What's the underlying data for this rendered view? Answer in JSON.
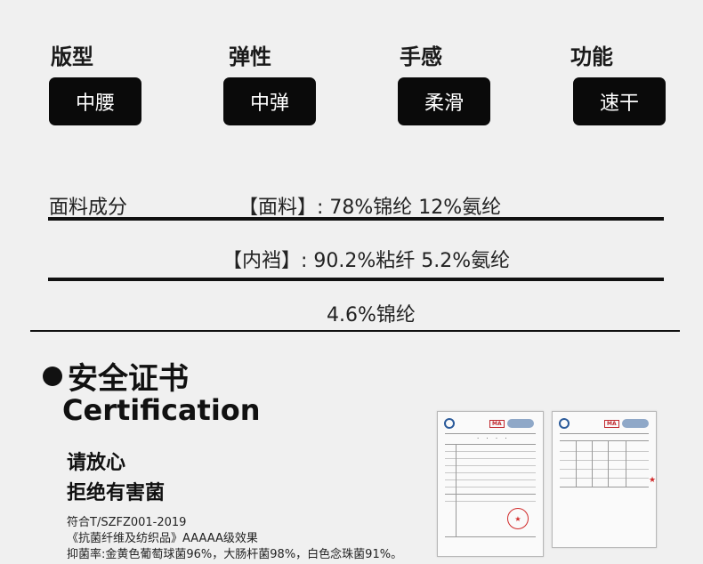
{
  "attributes": [
    {
      "label": "版型",
      "value": "中腰"
    },
    {
      "label": "弹性",
      "value": "中弹"
    },
    {
      "label": "手感",
      "value": "柔滑"
    },
    {
      "label": "功能",
      "value": "速干"
    }
  ],
  "fabric": {
    "label": "面料成分",
    "outer": "【面料】: 78%锦纶 12%氨纶",
    "lining": "【内裆】: 90.2%粘纤 5.2%氨纶",
    "lining_cont": "4.6%锦纶"
  },
  "certification": {
    "title": "安全证书",
    "subtitle": "Certification",
    "reassure_line1": "请放心",
    "reassure_line2": "拒绝有害菌",
    "standard_line1": "符合T/SZFZ001-2019",
    "standard_line2": "《抗菌纤维及纺织品》AAAAA级效果",
    "standard_line3": "抑菌率:金黄色葡萄球菌96%，大肠杆菌98%，白色念珠菌91%。"
  },
  "colors": {
    "tag_bg": "#0a0a0a",
    "tag_text": "#ffffff",
    "page_bg": "#f0f0f0",
    "stamp_red": "#d12a2a"
  }
}
